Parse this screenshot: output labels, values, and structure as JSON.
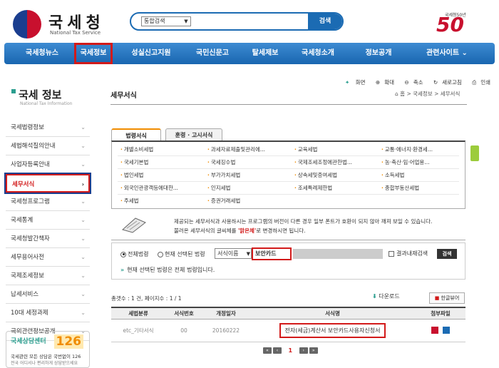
{
  "header": {
    "logo_text": "국세청",
    "logo_sub": "National Tax Service",
    "search_scope": "통합검색",
    "search_button": "검색",
    "anniv_label": "국세청50년",
    "anniv_num": "50"
  },
  "nav": {
    "items": [
      "국세청뉴스",
      "국세정보",
      "성실신고지원",
      "국민신문고",
      "탈세제보",
      "국세청소개",
      "정보공개",
      "관련사이트"
    ],
    "active": "국세정보"
  },
  "sidebar": {
    "title": "국세 정보",
    "subtitle": "National Tax Information",
    "items": [
      "국세법령정보",
      "세법해석질의안내",
      "사업자등록안내",
      "세무서식",
      "국세청프로그램",
      "국세통계",
      "국세청발간책자",
      "세무용어사전",
      "국제조세정보",
      "납세서비스",
      "10대 세정과제",
      "국외관련정보공개"
    ],
    "active_index": 3,
    "promo_title": "국세상담센터",
    "promo_num": "126",
    "promo_line1": "국세관련 모든 상담은 국번없이 126",
    "promo_line2": "전국 어디서나 편리하게 상담받으세요"
  },
  "main": {
    "title": "세무서식",
    "tools": [
      "화면",
      "확대",
      "축소",
      "새로고침",
      "인쇄"
    ],
    "breadcrumb": "홈 > 국세정보 > 세무서식",
    "tabs": [
      "법령서식",
      "훈령 · 고시서식"
    ],
    "categories": [
      [
        "개별소비세법",
        "과세자료제출및관리에...",
        "교육세법",
        "교통·에너지·환경세..."
      ],
      [
        "국세기본법",
        "국세징수법",
        "국제조세조정에관한법...",
        "농·축산·임·어업용..."
      ],
      [
        "법인세법",
        "부가가치세법",
        "상속세및증여세법",
        "소득세법"
      ],
      [
        "외국인관광객등에대한...",
        "인지세법",
        "조세특례제한법",
        "종합부동산세법"
      ],
      [
        "주세법",
        "증권거래세법"
      ]
    ],
    "notice_line1": "제공되는 세무서식과 사용하시는 프로그램의 버전이 다른 경우 일부 폰트가 호환이 되지 않아 깨져 보일 수 있습니다.",
    "notice_line2_a": "불러온 세무서식의 글씨체를 ",
    "notice_line2_b": "'맑은체'",
    "notice_line2_c": "로 변경하시면 됩니다.",
    "filter": {
      "radio_all": "전체법령",
      "radio_current": "현재 선택된 법령",
      "select_value": "서식이름",
      "input_value": "보안카드",
      "check_label": "결과내재검색",
      "search_button": "검색",
      "note": "현재 선택된 법령은 전체 법령입니다."
    },
    "result_count": "총갯수 : 1 건, 페이지수 : 1 / 1",
    "download_label": "다운로드",
    "hwp_button": "한글뷰어",
    "table": {
      "headers": [
        "세법분류",
        "서식번호",
        "개정일자",
        "서식명",
        "첨부파일"
      ],
      "rows": [
        {
          "category": "etc_기타서식",
          "number": "00",
          "date": "20160222",
          "title": "전자(세금)계산서 보안카드사용자신청서"
        }
      ]
    },
    "pager": {
      "current": "1"
    }
  }
}
